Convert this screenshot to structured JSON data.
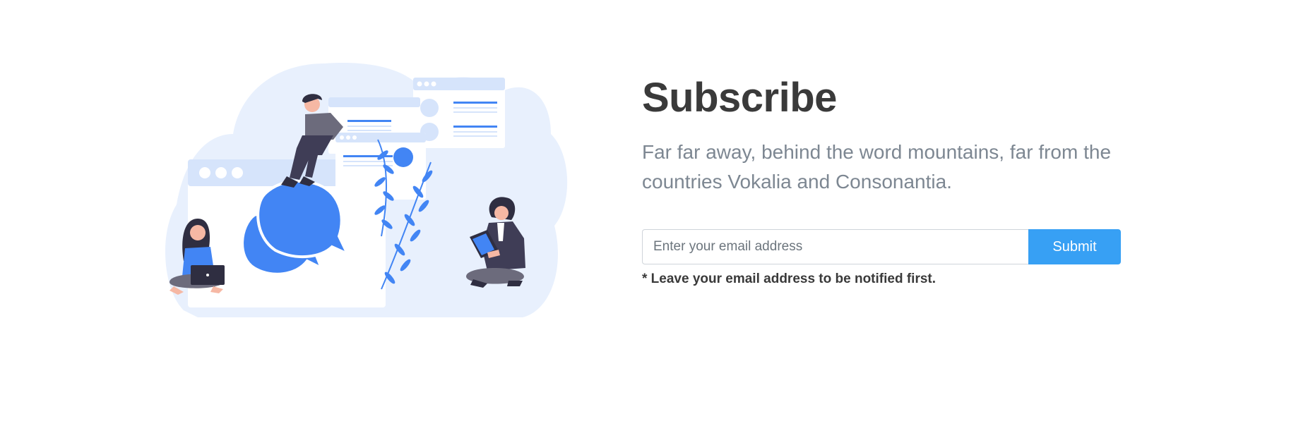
{
  "subscribe": {
    "title": "Subscribe",
    "lead": "Far far away, behind the word mountains, far from the countries Vokalia and Consonantia.",
    "email_placeholder": "Enter your email address",
    "submit_label": "Submit",
    "note": "* Leave your email address to be notified first."
  },
  "illustration": {
    "subject": "people-chatting-illustration"
  },
  "colors": {
    "accent_blue": "#4285f4",
    "button_blue": "#37a0f4",
    "cloud_bg": "#e8f0fd",
    "window_header": "#d6e4fb",
    "title_text": "#3a3a3a",
    "lead_text": "#7d8792",
    "dark_clothes": "#3f3d56"
  }
}
